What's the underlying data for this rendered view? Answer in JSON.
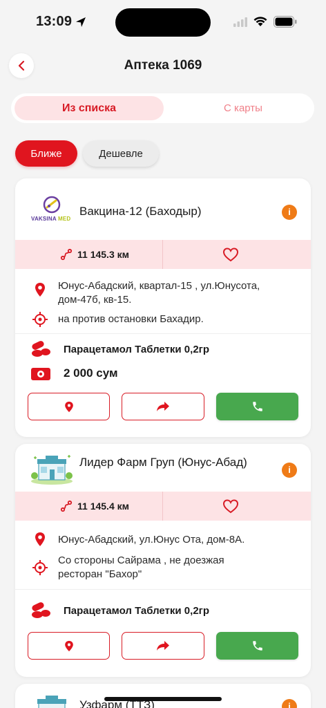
{
  "status_bar": {
    "time": "13:09"
  },
  "header": {
    "title": "Аптека 1069"
  },
  "segment": {
    "tab_list": "Из списка",
    "tab_map": "С карты"
  },
  "filters": {
    "near": "Ближе",
    "cheap": "Дешевле"
  },
  "colors": {
    "accent": "#e0151f",
    "call_green": "#48a84e",
    "info_orange": "#ef7b17",
    "stats_bg": "#fde3e5"
  },
  "cards": [
    {
      "name": "Вакцина-12 (Баходыр)",
      "logo_text_1": "VAKSINA",
      "logo_text_2": "MED",
      "distance": "11 145.3 км",
      "address": "Юнус-Абадский, квартал-15 , ул.Юнусота, дом-47б, кв-15.",
      "landmark": "на против остановки Бахадир.",
      "drug": "Парацетамол Таблетки 0,2гр",
      "price": "2 000 сум"
    },
    {
      "name": "Лидер Фарм Груп (Юнус-Абад)",
      "distance": "11 145.4 км",
      "address": "Юнус-Абадский, ул.Юнус Ота, дом-8А.",
      "landmark": "Со стороны Сайрама , не доезжая ресторан \"Бахор\"",
      "drug": "Парацетамол Таблетки 0,2гр"
    },
    {
      "name": "Узфарм (ТТЗ)"
    }
  ]
}
